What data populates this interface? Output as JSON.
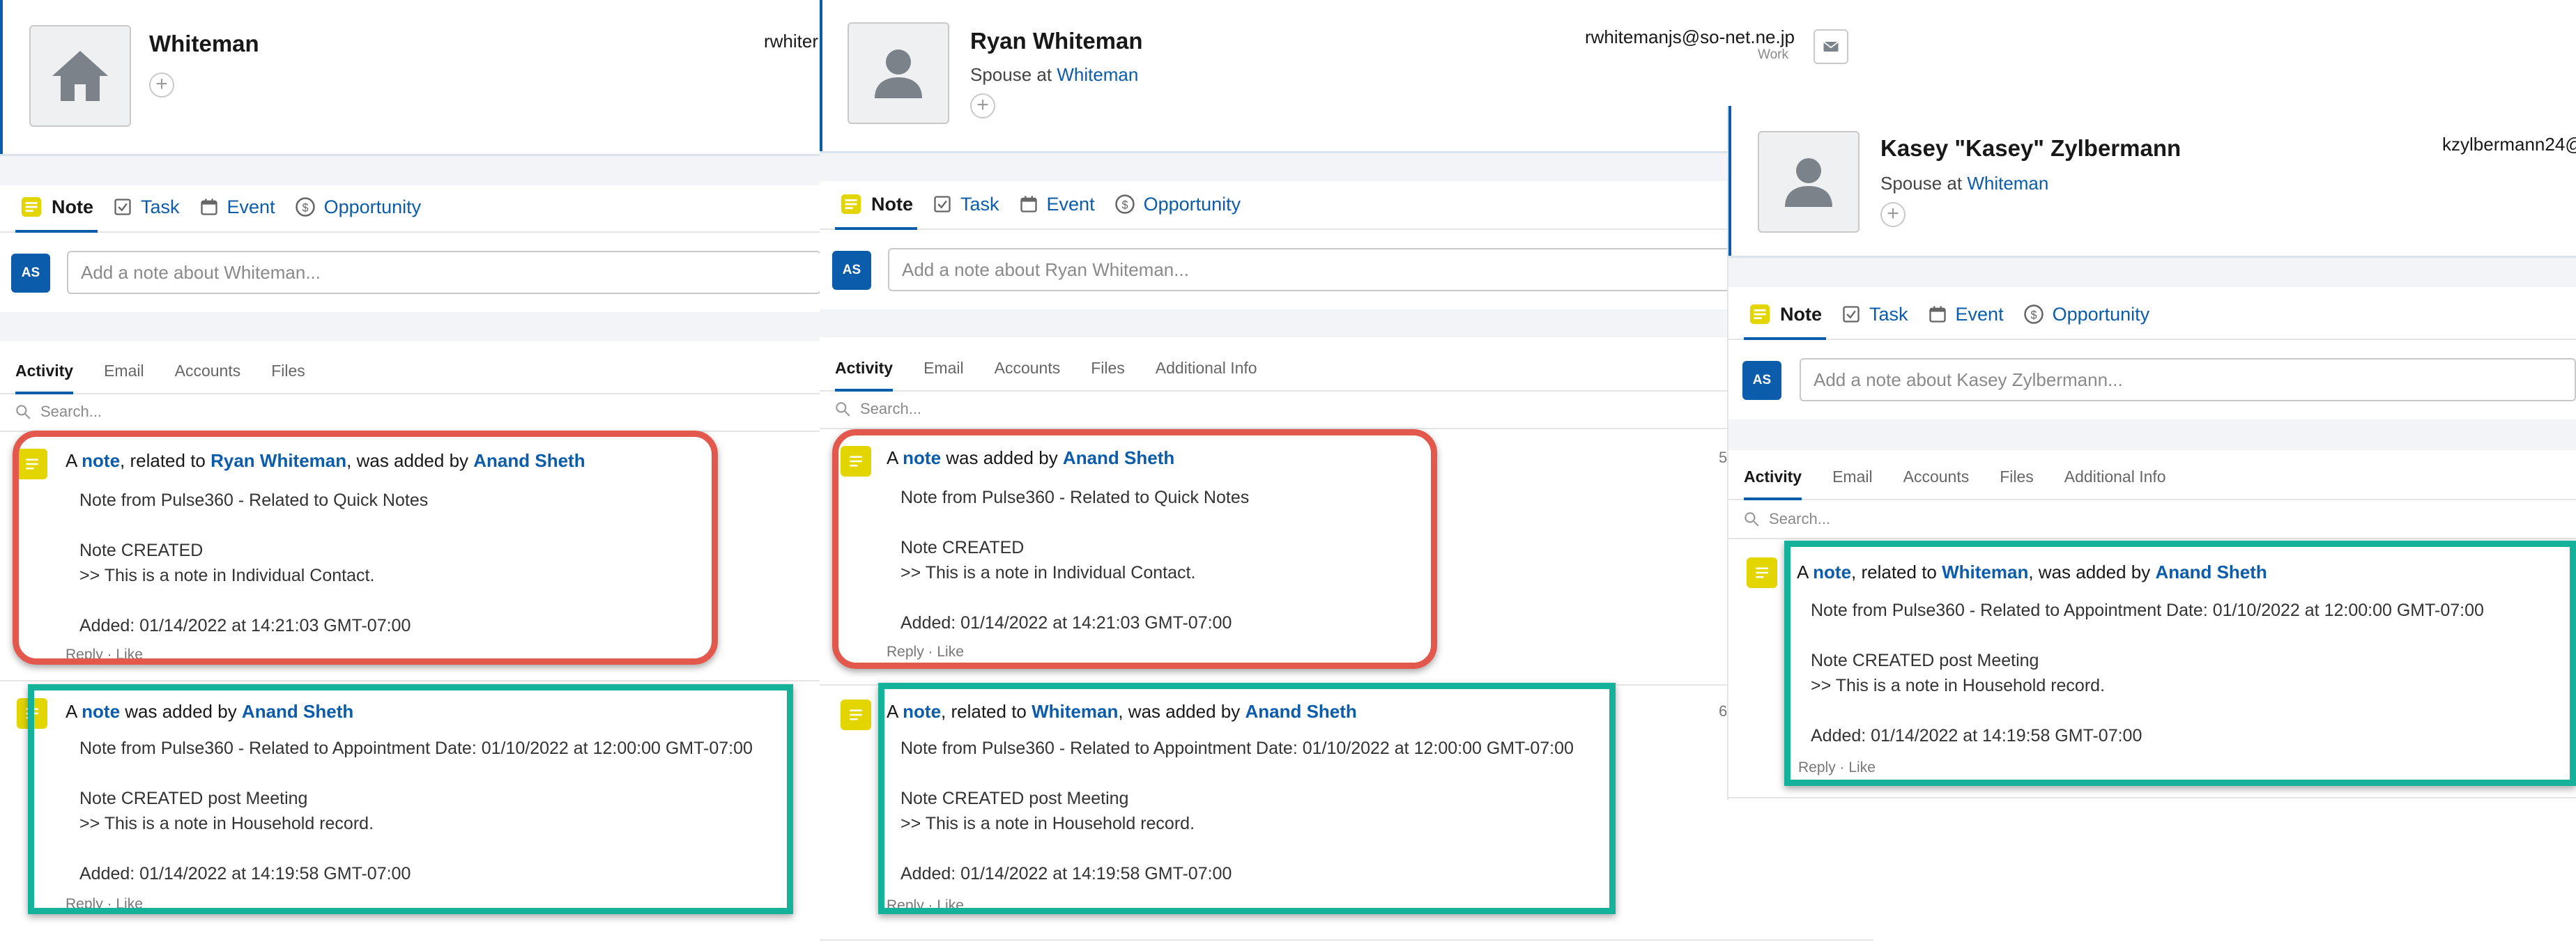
{
  "colors": {
    "link": "#0b5cab",
    "red_highlight": "#e2584c",
    "teal_highlight": "#14b29a",
    "note_icon": "#e3d500"
  },
  "publisher_tabs": {
    "note": "Note",
    "task": "Task",
    "event": "Event",
    "opportunity": "Opportunity"
  },
  "actions": "Reply · Like",
  "panel1": {
    "record_name": "Whiteman",
    "email": "rwhiter",
    "avatar_icon": "home-icon",
    "user_initials": "AS",
    "note_placeholder": "Add a note about Whiteman...",
    "feed_tabs": [
      "Activity",
      "Email",
      "Accounts",
      "Files"
    ],
    "search_placeholder": "Search...",
    "items": [
      {
        "pre": "A ",
        "note": "note",
        "mid1": ", related to ",
        "related": "Ryan Whiteman",
        "mid2": ", was added by ",
        "author": "Anand Sheth",
        "body": "Note from Pulse360 - Related to Quick Notes\n\nNote CREATED\n>> This is a note in Individual Contact.\n\nAdded: 01/14/2022 at 14:21:03 GMT-07:00"
      },
      {
        "pre": "A ",
        "note": "note",
        "mid2": " was added by ",
        "author": "Anand Sheth",
        "body": "Note from Pulse360 - Related to Appointment Date: 01/10/2022 at 12:00:00 GMT-07:00\n\nNote CREATED post Meeting\n>> This is a note in Household record.\n\nAdded: 01/14/2022 at 14:19:58 GMT-07:00"
      }
    ]
  },
  "panel2": {
    "record_name": "Ryan Whiteman",
    "subtitle_prefix": "Spouse at ",
    "subtitle_link": "Whiteman",
    "email": "rwhitemanjs@so-net.ne.jp",
    "email_type": "Work",
    "avatar_icon": "person-icon",
    "user_initials": "AS",
    "note_placeholder": "Add a note about Ryan Whiteman...",
    "feed_tabs": [
      "Activity",
      "Email",
      "Accounts",
      "Files",
      "Additional Info"
    ],
    "search_placeholder": "Search...",
    "side_num_1": "5",
    "side_num_2": "6",
    "items": [
      {
        "pre": "A ",
        "note": "note",
        "mid2": " was added by ",
        "author": "Anand Sheth",
        "body": "Note from Pulse360 - Related to Quick Notes\n\nNote CREATED\n>> This is a note in Individual Contact.\n\nAdded: 01/14/2022 at 14:21:03 GMT-07:00"
      },
      {
        "pre": "A ",
        "note": "note",
        "mid1": ", related to ",
        "related": "Whiteman",
        "mid2": ", was added by ",
        "author": "Anand Sheth",
        "body": "Note from Pulse360 - Related to Appointment Date: 01/10/2022 at 12:00:00 GMT-07:00\n\nNote CREATED post Meeting\n>> This is a note in Household record.\n\nAdded: 01/14/2022 at 14:19:58 GMT-07:00"
      }
    ]
  },
  "panel3": {
    "record_name": "Kasey \"Kasey\" Zylbermann",
    "subtitle_prefix": "Spouse at ",
    "subtitle_link": "Whiteman",
    "email": "kzylbermann24@",
    "avatar_icon": "person-icon",
    "user_initials": "AS",
    "note_placeholder": "Add a note about Kasey Zylbermann...",
    "feed_tabs": [
      "Activity",
      "Email",
      "Accounts",
      "Files",
      "Additional Info"
    ],
    "search_placeholder": "Search...",
    "items": [
      {
        "pre": "A ",
        "note": "note",
        "mid1": ", related to ",
        "related": "Whiteman",
        "mid2": ", was added by ",
        "author": "Anand Sheth",
        "body": "Note from Pulse360 - Related to Appointment Date: 01/10/2022 at 12:00:00 GMT-07:00\n\nNote CREATED post Meeting\n>> This is a note in Household record.\n\nAdded: 01/14/2022 at 14:19:58 GMT-07:00"
      }
    ]
  }
}
